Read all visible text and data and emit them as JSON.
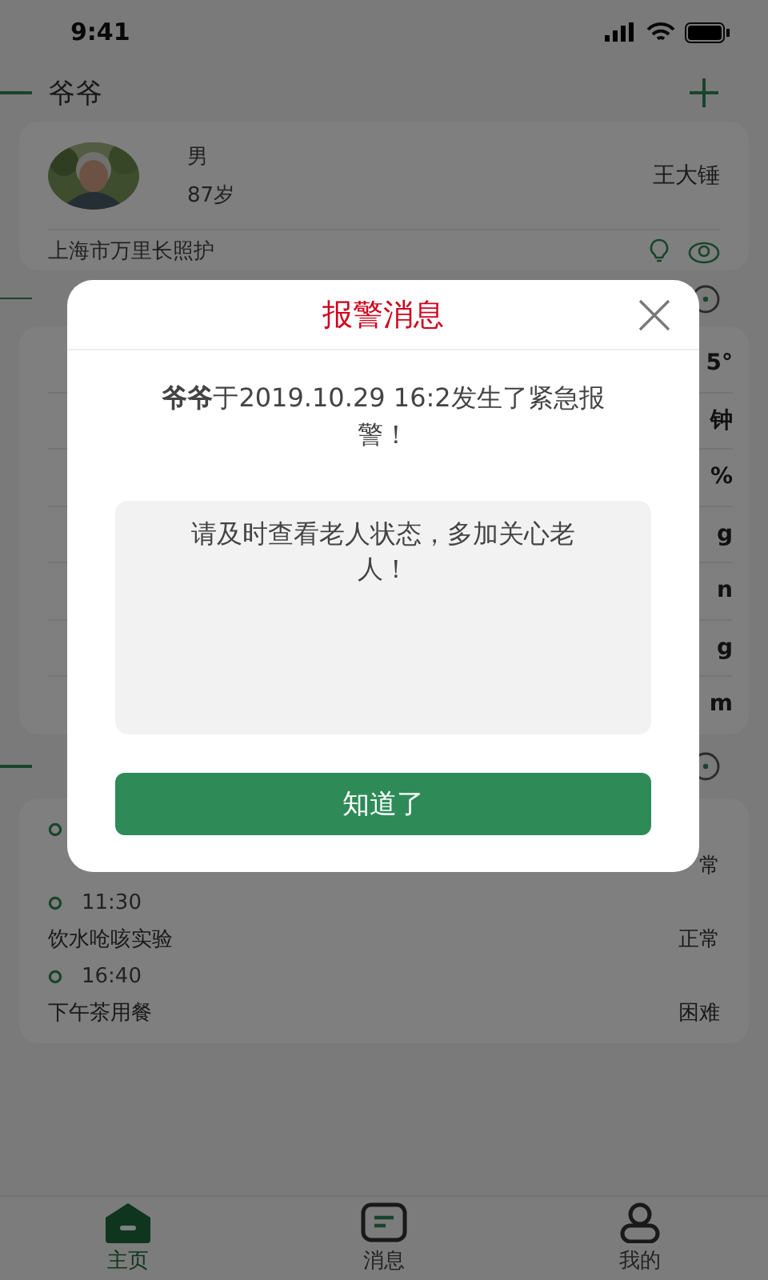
{
  "status_bar": {
    "time": "9:41"
  },
  "elder": {
    "title": "爷爷",
    "gender": "男",
    "age": "87岁",
    "caregiver": "王大锤",
    "agency": "上海市万里长照护"
  },
  "basic_info": {
    "values": [
      "5°",
      "钟",
      "%",
      "g",
      "n",
      "g",
      "m"
    ]
  },
  "daily": {
    "items": [
      {
        "status": "常"
      },
      {
        "time": "11:30",
        "activity": "饮水呛咳实验",
        "status": "正常"
      },
      {
        "time": "16:40",
        "activity": "下午茶用餐",
        "status": "困难"
      }
    ]
  },
  "tabs": [
    {
      "label": "主页",
      "selected": true
    },
    {
      "label": "消息",
      "selected": false
    },
    {
      "label": "我的",
      "selected": false
    }
  ],
  "alert": {
    "title": "报警消息",
    "message": "**爷爷**于2019.10.29 16:2发生了紧急报警！",
    "note": "请及时查看老人状态，多加关心老人！",
    "button": "知道了"
  }
}
